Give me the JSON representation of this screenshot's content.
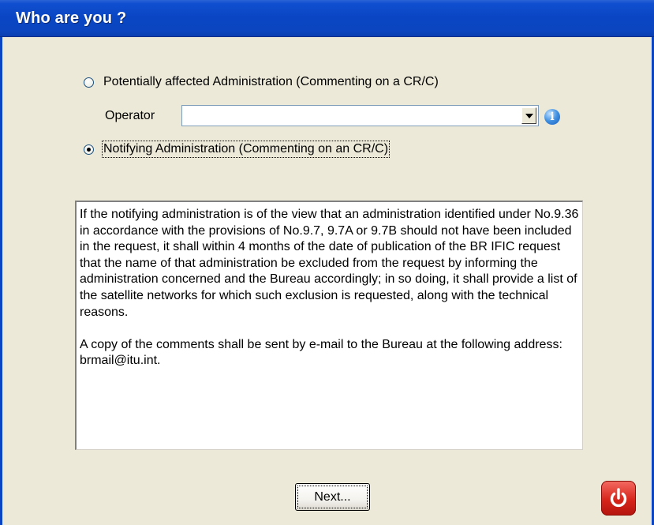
{
  "window": {
    "title": "Who are you ?"
  },
  "options": {
    "affected_label": "Potentially affected Administration (Commenting on a CR/C)",
    "affected_selected": false,
    "notifying_label": "Notifying Administration (Commenting on an CR/C)",
    "notifying_selected": true
  },
  "operator": {
    "label": "Operator",
    "value": ""
  },
  "info_text": {
    "paragraph1": "If the notifying administration is of the view that an administration identified under No.9.36 in accordance with the provisions of No.9.7, 9.7A or 9.7B should not have been included in the request, it shall within 4 months of the date of publication of the BR IFIC request that the name of that administration be excluded from the request by informing the administration concerned and the Bureau accordingly; in so doing, it shall provide a list of the satellite networks for which such exclusion is requested, along with the technical reasons.",
    "paragraph2": "A copy of the comments shall be sent by e-mail to the Bureau at the following address: brmail@itu.int."
  },
  "buttons": {
    "next_label": "Next..."
  },
  "icons": {
    "info": "info-icon",
    "power": "power-icon",
    "dropdown": "chevron-down-icon"
  },
  "colors": {
    "titlebar": "#0a46c4",
    "background": "#ece9d8",
    "power_button": "#d7251b"
  }
}
